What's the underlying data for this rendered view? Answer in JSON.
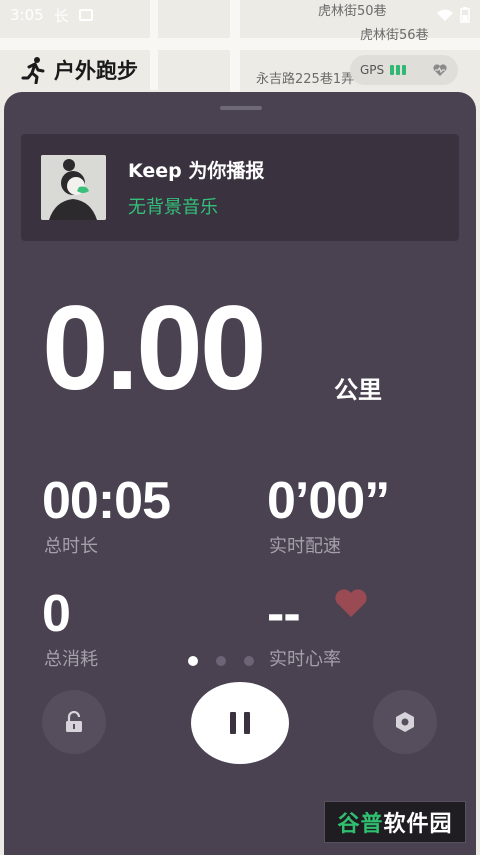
{
  "status_bar": {
    "time": "3:05",
    "left_icons": [
      "sim-icon",
      "notification-icon"
    ],
    "right_icons": [
      "wifi-icon",
      "battery-icon"
    ]
  },
  "map": {
    "labels": [
      "虎林街50巷",
      "虎林街56巷",
      "永吉路225巷1弄"
    ]
  },
  "header": {
    "title": "户外跑步",
    "gps_label": "GPS",
    "gps_bars": 3
  },
  "voice": {
    "title": "Keep 为你播报",
    "subtitle": "无背景音乐"
  },
  "distance": {
    "value": "0.00",
    "unit": "公里"
  },
  "stats": {
    "duration": {
      "value": "00:05",
      "label": "总时长"
    },
    "pace": {
      "value": "0’00”",
      "label": "实时配速"
    },
    "calories": {
      "value": "0",
      "label": "总消耗"
    },
    "heart_rate": {
      "value": "--",
      "label": "实时心率"
    }
  },
  "pager": {
    "count": 3,
    "active": 0
  },
  "watermark": {
    "text_green": "谷普",
    "text_white": "软件园"
  },
  "colors": {
    "sheet": "#4a4250",
    "card": "#3a333f",
    "accent_green": "#33c07a",
    "heart": "#9a4a52"
  }
}
